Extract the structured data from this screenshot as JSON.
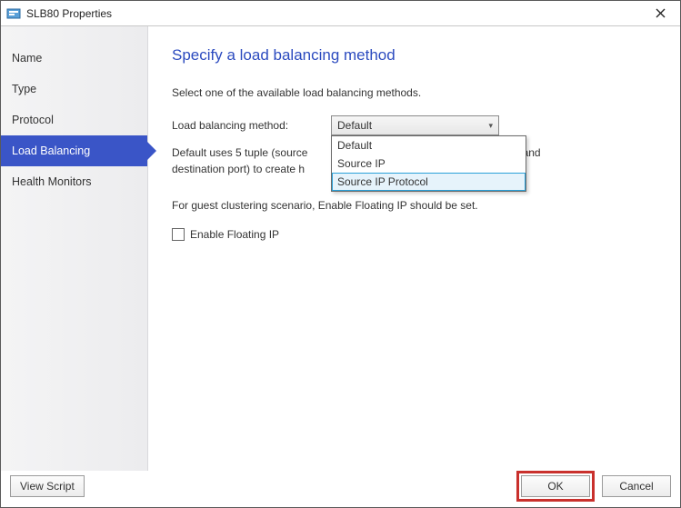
{
  "window": {
    "title": "SLB80 Properties"
  },
  "sidebar": {
    "items": [
      {
        "label": "Name"
      },
      {
        "label": "Type"
      },
      {
        "label": "Protocol"
      },
      {
        "label": "Load Balancing"
      },
      {
        "label": "Health Monitors"
      }
    ],
    "active_index": 3
  },
  "content": {
    "heading": "Specify a load balancing method",
    "intro": "Select one of the available load balancing methods.",
    "method_label": "Load balancing method:",
    "method_selected": "Default",
    "method_options": [
      "Default",
      "Source IP",
      "Source IP Protocol"
    ],
    "method_hover_index": 2,
    "tuple_line1": "Default uses 5 tuple (source",
    "tuple_line1_tail": "IP and",
    "tuple_line2": "destination port) to create h",
    "guest_text": "For guest clustering scenario, Enable Floating IP should be set.",
    "floating_label": "Enable Floating IP",
    "floating_checked": false
  },
  "footer": {
    "view_script": "View Script",
    "ok": "OK",
    "cancel": "Cancel"
  }
}
